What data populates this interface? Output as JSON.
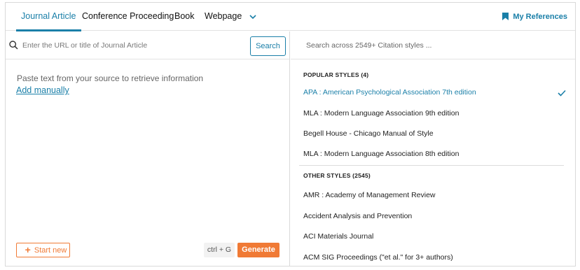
{
  "tabs": [
    {
      "label": "Journal Article",
      "active": true
    },
    {
      "label": "Conference Proceeding",
      "active": false
    },
    {
      "label": "Book",
      "active": false
    },
    {
      "label": "Webpage",
      "active": false
    }
  ],
  "more_tabs_icon": "chevron-down-icon",
  "my_references": {
    "label": "My References",
    "icon": "bookmark-icon"
  },
  "left": {
    "search_placeholder": "Enter the URL or title of Journal Article",
    "search_button": "Search",
    "paste_hint": "Paste text from your source to retrieve information",
    "add_manually": "Add manually",
    "start_new": "Start new",
    "shortcut": "ctrl + G",
    "generate": "Generate"
  },
  "right": {
    "search_placeholder": "Search across 2549+ Citation styles ...",
    "popular_heading": "POPULAR STYLES (4)",
    "popular_styles": [
      {
        "label": "APA : American Psychological Association 7th edition",
        "selected": true
      },
      {
        "label": "MLA : Modern Language Association 9th edition",
        "selected": false
      },
      {
        "label": "Begell House - Chicago Manual of Style",
        "selected": false
      },
      {
        "label": "MLA : Modern Language Association 8th edition",
        "selected": false
      }
    ],
    "other_heading": "OTHER STYLES (2545)",
    "other_styles": [
      {
        "label": "AMR : Academy of Management Review"
      },
      {
        "label": "Accident Analysis and Prevention"
      },
      {
        "label": "ACI Materials Journal"
      },
      {
        "label": "ACM SIG Proceedings (\"et al.\" for 3+ authors)"
      }
    ]
  },
  "colors": {
    "accent": "#1a7fa8",
    "action": "#f07a35"
  }
}
